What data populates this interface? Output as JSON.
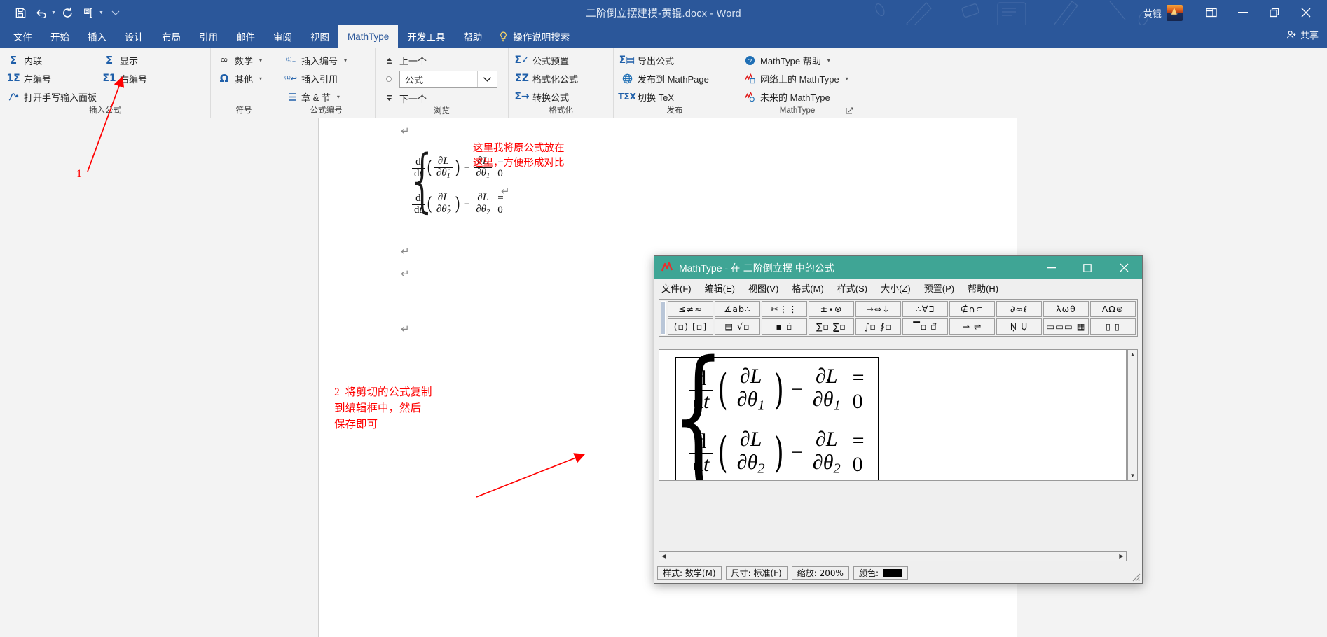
{
  "window": {
    "title": "二阶倒立摆建模-黄锟.docx  -  Word",
    "account_name": "黄锟",
    "share_label": "共享",
    "quick_access": [
      "save-icon",
      "undo-icon",
      "redo-icon",
      "touch-mode-icon",
      "customize-qat-icon"
    ],
    "controls": [
      "ribbon-display-options",
      "minimize",
      "restore",
      "close"
    ]
  },
  "tabs": [
    {
      "label": "文件",
      "active": false
    },
    {
      "label": "开始",
      "active": false
    },
    {
      "label": "插入",
      "active": false
    },
    {
      "label": "设计",
      "active": false
    },
    {
      "label": "布局",
      "active": false
    },
    {
      "label": "引用",
      "active": false
    },
    {
      "label": "邮件",
      "active": false
    },
    {
      "label": "审阅",
      "active": false
    },
    {
      "label": "视图",
      "active": false
    },
    {
      "label": "MathType",
      "active": true
    },
    {
      "label": "开发工具",
      "active": false
    },
    {
      "label": "帮助",
      "active": false
    }
  ],
  "tell_me": "操作说明搜索",
  "ribbon": {
    "groups": [
      {
        "label": "插入公式",
        "columns": [
          {
            "items": [
              {
                "label": "内联",
                "icon": "sigma-inline-icon",
                "dropdown": false
              },
              {
                "label": "左编号",
                "icon": "sigma-left-number-icon",
                "dropdown": false
              },
              {
                "label": "打开手写输入面板",
                "icon": "handwriting-icon",
                "dropdown": false
              }
            ]
          },
          {
            "items": [
              {
                "label": "显示",
                "icon": "sigma-display-icon",
                "dropdown": false
              },
              {
                "label": "右编号",
                "icon": "sigma-right-number-icon",
                "dropdown": false
              }
            ]
          }
        ]
      },
      {
        "label": "符号",
        "columns": [
          {
            "items": [
              {
                "label": "数学",
                "icon": "infinity-icon",
                "dropdown": true
              },
              {
                "label": "其他",
                "icon": "omega-icon",
                "dropdown": true
              }
            ]
          }
        ]
      },
      {
        "label": "公式编号",
        "columns": [
          {
            "items": [
              {
                "label": "插入编号",
                "icon": "insert-number-icon",
                "dropdown": true
              },
              {
                "label": "插入引用",
                "icon": "insert-reference-icon",
                "dropdown": false
              },
              {
                "label": "章 & 节",
                "icon": "chapter-section-icon",
                "dropdown": true
              }
            ]
          }
        ]
      },
      {
        "label": "浏览",
        "columns": [
          {
            "items": [
              {
                "label": "上一个",
                "icon": "previous-icon",
                "dropdown": false
              },
              {
                "label": "下一个",
                "icon": "next-icon",
                "dropdown": false
              }
            ]
          }
        ],
        "combo": {
          "value": "公式",
          "icon": "browse-object-icon"
        }
      },
      {
        "label": "格式化",
        "columns": [
          {
            "items": [
              {
                "label": "公式预置",
                "icon": "equation-preferences-icon",
                "dropdown": false
              },
              {
                "label": "格式化公式",
                "icon": "format-equations-icon",
                "dropdown": false
              },
              {
                "label": "转换公式",
                "icon": "convert-equations-icon",
                "dropdown": false
              }
            ]
          }
        ]
      },
      {
        "label": "发布",
        "columns": [
          {
            "items": [
              {
                "label": "导出公式",
                "icon": "export-equations-icon",
                "dropdown": false
              },
              {
                "label": "发布到 MathPage",
                "icon": "globe-icon",
                "dropdown": false
              },
              {
                "label": "切换 TeX",
                "icon": "toggle-tex-icon",
                "dropdown": false
              }
            ]
          }
        ]
      },
      {
        "label": "MathType",
        "columns": [
          {
            "items": [
              {
                "label": "MathType 帮助",
                "icon": "help-icon",
                "dropdown": true
              },
              {
                "label": "网络上的 MathType",
                "icon": "mathtype-web-icon",
                "dropdown": true
              },
              {
                "label": "未来的 MathType",
                "icon": "mathtype-future-icon",
                "dropdown": false
              }
            ]
          }
        ],
        "has_dialog_launcher": true
      }
    ]
  },
  "document": {
    "equation": {
      "lines": [
        {
          "num1": "d",
          "den1": "dt",
          "num2": "∂L",
          "den2": "∂θ",
          "sub": "1",
          "tail": "− ∂L/∂θ1 = 0"
        },
        {
          "num1": "d",
          "den1": "dt",
          "num2": "∂L",
          "den2": "∂θ",
          "sub": "2",
          "tail": "− ∂L/∂θ2 = 0"
        }
      ],
      "subscripts": [
        "1",
        "2"
      ],
      "rhs": "= 0"
    },
    "annotations": [
      {
        "name": "annotation-step-1-marker",
        "text": "1",
        "color": "#ff0000"
      },
      {
        "name": "annotation-original-formula",
        "text": "这里我将原公式放在\n这里，方便形成对比",
        "color": "#ff0000"
      },
      {
        "name": "annotation-step-2",
        "text": "2  将剪切的公式复制\n到编辑框中，然后\n保存即可",
        "color": "#ff0000"
      }
    ]
  },
  "mathtype_dialog": {
    "title": "MathType - 在 二阶倒立摆 中的公式",
    "title_controls": [
      "minimize",
      "maximize",
      "close"
    ],
    "menu": [
      "文件(F)",
      "编辑(E)",
      "视图(V)",
      "格式(M)",
      "样式(S)",
      "大小(Z)",
      "预置(P)",
      "帮助(H)"
    ],
    "toolbar_rows": [
      [
        "≤≠≈",
        "∡ab∴",
        "✂⋮⋮",
        "±∙⊗",
        "→⇔↓",
        "∴∀∃",
        "∉∩⊂",
        "∂∞ℓ",
        "λωθ",
        "ΛΩ⊛"
      ],
      [
        "(▫) [▫]",
        "▤ √▫",
        "▪ ▫̇",
        "∑▫ ∑̲▫",
        "∫▫ ∮▫",
        "▔▫ ▫⃗",
        "⇀ ⇌",
        "Ṇ Ụ",
        "▭▭▭ ▦",
        "▯ ▯"
      ]
    ],
    "equation": {
      "lines": [
        {
          "d": "d",
          "dt": "dt",
          "partial_L": "∂L",
          "partial_theta": "∂θ",
          "sub": "1",
          "rhs": "= 0"
        },
        {
          "d": "d",
          "dt": "dt",
          "partial_L": "∂L",
          "partial_theta": "∂θ",
          "sub": "2",
          "rhs": "= 0"
        }
      ]
    },
    "status": {
      "style_label": "样式:",
      "style_value": "数学(M)",
      "size_label": "尺寸:",
      "size_value": "标准(F)",
      "zoom_label": "缩放:",
      "zoom_value": "200%",
      "color_label": "颜色:",
      "color_value": "#000000"
    }
  },
  "colors": {
    "word_blue": "#2b579a",
    "mathtype_teal": "#3fa595",
    "annotation_red": "#ff0000",
    "ribbon_bg": "#f3f3f3"
  }
}
